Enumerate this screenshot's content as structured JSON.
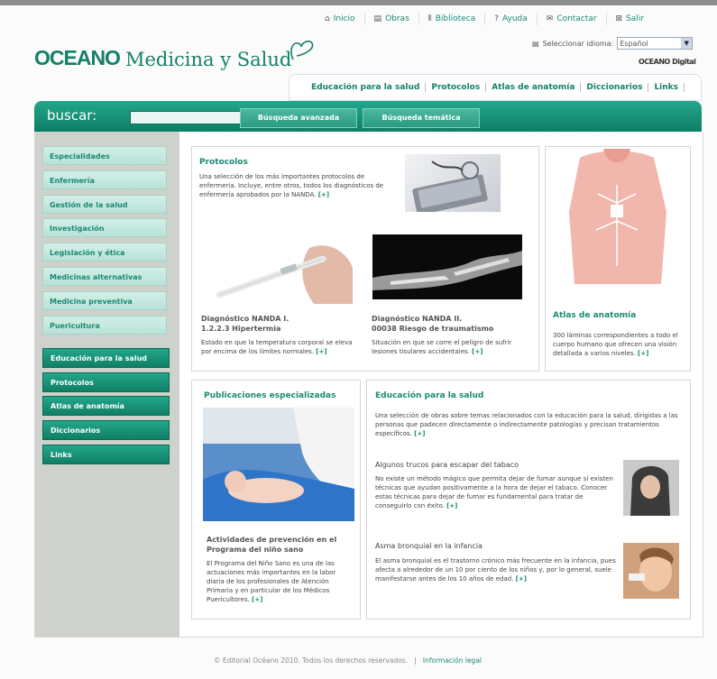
{
  "toplinks": [
    {
      "icon": "home-icon",
      "glyph": "⌂",
      "label": "Inicio"
    },
    {
      "icon": "book-icon",
      "glyph": "▤",
      "label": "Obras"
    },
    {
      "icon": "library-icon",
      "glyph": "⦀",
      "label": "Biblioteca"
    },
    {
      "icon": "help-icon",
      "glyph": "?",
      "label": "Ayuda"
    },
    {
      "icon": "mail-icon",
      "glyph": "✉",
      "label": "Contactar"
    },
    {
      "icon": "exit-icon",
      "glyph": "⊠",
      "label": "Salir"
    }
  ],
  "logo": {
    "brand": "OCEANO",
    "title": "Medicina y Salud"
  },
  "language": {
    "label": "Seleccionar idioma:",
    "value": "Español"
  },
  "oceano_digital": "OCEANO Digital",
  "secnav": [
    "Educación para la salud",
    "Protocolos",
    "Atlas de anatomía",
    "Diccionarios",
    "Links"
  ],
  "search": {
    "label": "buscar:",
    "advanced": "Búsqueda avanzada",
    "thematic": "Búsqueda temática"
  },
  "sidebar": {
    "specialties": [
      "Especialidades",
      "Enfermería",
      "Gestión de la salud",
      "Investigación",
      "Legislación y ética",
      "Medicinas alternativas",
      "Medicina preventiva",
      "Puericultura"
    ],
    "sections": [
      "Educación para la salud",
      "Protocolos",
      "Atlas de anatomía",
      "Diccionarios",
      "Links"
    ]
  },
  "protocolos": {
    "title": "Protocolos",
    "text": "Una selección de los más importantes protocolos de enfermería. Incluye, entre otros, todos los diagnósticos de enfermería aprobados por la NANDA.",
    "more": "[+]",
    "d1_title": "Diagnóstico NANDA I.",
    "d1_sub": "1.2.2.3 Hipertermia",
    "d1_text": "Estado en que la temperatura corporal se eleva por encima de los límites normales.",
    "d2_title": "Diagnóstico NANDA II.",
    "d2_sub": "00038 Riesgo de traumatismo",
    "d2_text": "Situación en que se corre el peligro de sufrir lesiones tisulares accidentales."
  },
  "atlas": {
    "title": "Atlas de anatomía",
    "text": "300 láminas correspondientes a todo el cuerpo humano que ofrecen una visión detallada a varios niveles.",
    "more": "[+]"
  },
  "publicaciones": {
    "title": "Publicaciones especializadas",
    "sub": "Actividades de prevención en el Programa del niño sano",
    "text": "El Programa del Niño Sano es una de las actuaciones más importantes en la labor diaria de los profesionales de Atención Primaria y en particular de los Médicos Puericultores.",
    "more": "[+]"
  },
  "educacion": {
    "title": "Educación para la salud",
    "text": "Una selección de obras sobre temas relacionados con la educación para la salud, dirigidas a las personas que padecen directamente o indirectamente patologías y precisan tratamientos específicos.",
    "more": "[+]",
    "a1_title": "Algunos trucos para escapar del tabaco",
    "a1_text": "No existe un método mágico que permita dejar de fumar aunque sí existen técnicas que ayudan positivamente a la hora de dejar el tabaco. Conocer estas técnicas para dejar de fumar es fundamental para tratar de conseguirlo con éxito.",
    "a2_title": "Asma bronquial en la infancia",
    "a2_text": "El asma bronquial es el trastorno crónico más frecuente en la infancia, pues afecta a alrededor de un 10 por ciento de los niños y, por lo general, suele manifestarse antes de los 10 años de edad."
  },
  "footer": {
    "copyright": "© Editorial Océano 2010. Todos los derechos reservados.",
    "sep": "|",
    "legal": "Información legal"
  },
  "colors": {
    "accent": "#14806a",
    "sidebar_bg": "#cfd2cc",
    "bar": "#1c9a7e"
  }
}
